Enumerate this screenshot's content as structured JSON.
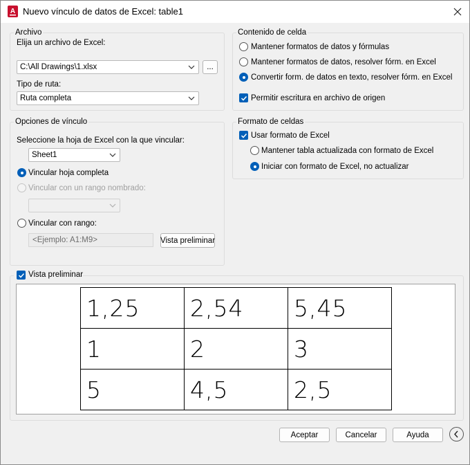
{
  "window": {
    "title": "Nuevo vínculo de datos de Excel: table1"
  },
  "archivo": {
    "legend": "Archivo",
    "file_label": "Elija un archivo de Excel:",
    "file_value": "C:\\All Drawings\\1.xlsx",
    "browse_label": "...",
    "path_type_label": "Tipo de ruta:",
    "path_type_value": "Ruta completa"
  },
  "contenido": {
    "legend": "Contenido de celda",
    "options": [
      "Mantener formatos de datos y fórmulas",
      "Mantener formatos de datos, resolver fórm. en Excel",
      "Convertir form. de datos en texto, resolver fórm. en Excel"
    ],
    "selected_index": 2,
    "allow_write_label": "Permitir escritura en archivo de origen",
    "allow_write_checked": true
  },
  "opciones": {
    "legend": "Opciones de vínculo",
    "sheet_label": "Seleccione la hoja de Excel con la que vincular:",
    "sheet_value": "Sheet1",
    "link_entire": "Vincular hoja completa",
    "link_named": "Vincular con un rango nombrado:",
    "named_value": "",
    "link_range": "Vincular con rango:",
    "range_placeholder": "<Ejemplo: A1:M9>",
    "preview_button": "Vista preliminar",
    "selected": "link_entire"
  },
  "formato": {
    "legend": "Formato de celdas",
    "use_excel_label": "Usar formato de Excel",
    "use_excel_checked": true,
    "keep_updated": "Mantener tabla actualizada con formato de Excel",
    "start_no_update": "Iniciar con formato de Excel, no actualizar",
    "selected": "start_no_update"
  },
  "preview": {
    "label": "Vista preliminar",
    "checked": true,
    "rows": [
      [
        "1,25",
        "2,54",
        "5,45"
      ],
      [
        "1",
        "2",
        "3"
      ],
      [
        "5",
        "4,5",
        "2,5"
      ]
    ]
  },
  "footer": {
    "ok": "Aceptar",
    "cancel": "Cancelar",
    "help": "Ayuda"
  },
  "colors": {
    "accent": "#005fb8",
    "app_icon": "#c8102e"
  }
}
